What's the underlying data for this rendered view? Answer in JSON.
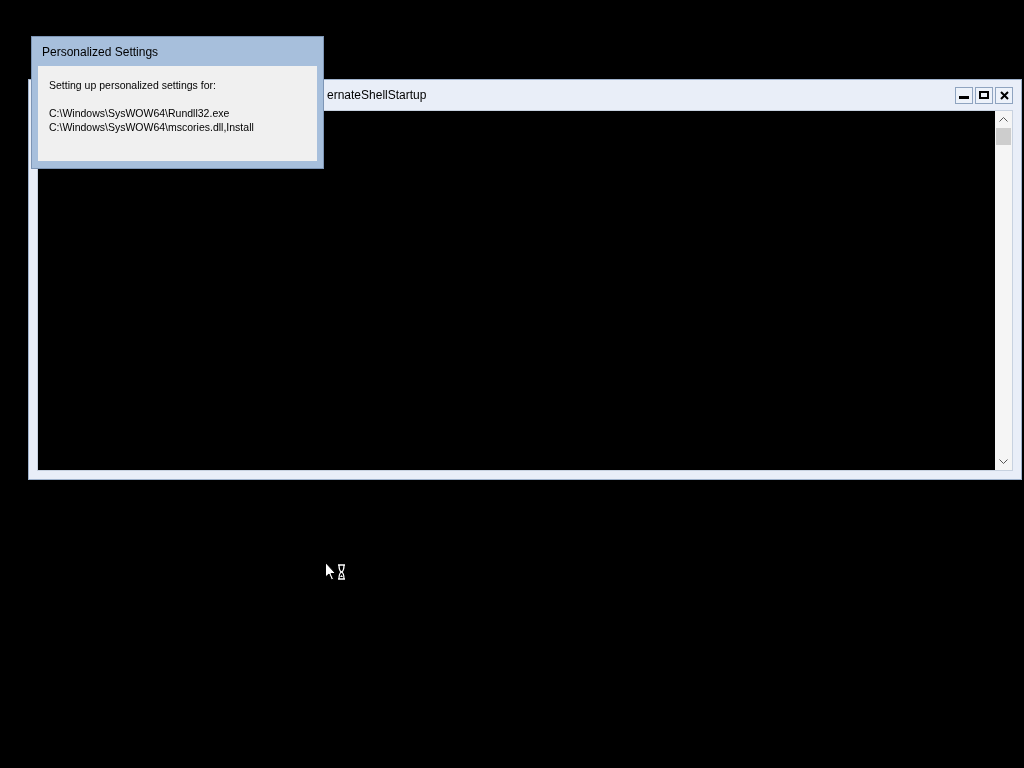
{
  "console_window": {
    "title": "ernateShellStartup"
  },
  "popup": {
    "title": "Personalized Settings",
    "heading": "Setting up personalized settings for:",
    "lines": [
      "C:\\Windows\\SysWOW64\\Rundll32.exe",
      "C:\\Windows\\SysWOW64\\mscories.dll,Install"
    ]
  }
}
